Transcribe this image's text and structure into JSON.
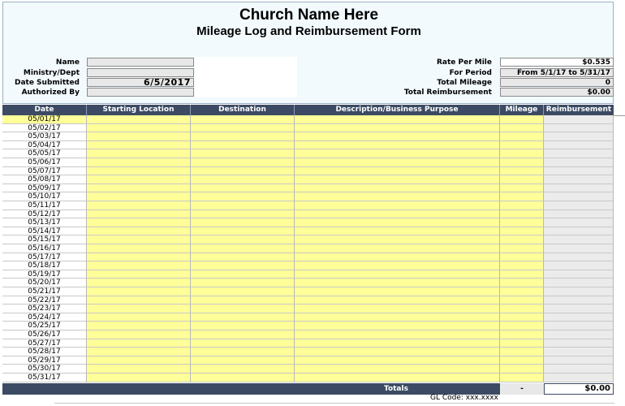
{
  "header": {
    "church_name": "Church Name Here",
    "form_title": "Mileage Log and Reimbursement Form"
  },
  "left_info": [
    {
      "label": "Name",
      "value": ""
    },
    {
      "label": "Ministry/Dept",
      "value": ""
    },
    {
      "label": "Date Submitted",
      "value": "6/5/2017"
    },
    {
      "label": "Authorized By",
      "value": ""
    }
  ],
  "right_info": [
    {
      "label": "Rate Per Mile",
      "value": "$0.535"
    },
    {
      "label": "For Period",
      "value": "From 5/1/17 to 5/31/17"
    },
    {
      "label": "Total Mileage",
      "value": "0"
    },
    {
      "label": "Total Reimbursement",
      "value": "$0.00"
    }
  ],
  "columns": [
    "Date",
    "Starting Location",
    "Destination",
    "Description/Business Purpose",
    "Mileage",
    "Reimbursement"
  ],
  "rows": [
    "05/01/17",
    "05/02/17",
    "05/03/17",
    "05/04/17",
    "05/05/17",
    "05/06/17",
    "05/07/17",
    "05/08/17",
    "05/09/17",
    "05/10/17",
    "05/11/17",
    "05/12/17",
    "05/13/17",
    "05/14/17",
    "05/15/17",
    "05/16/17",
    "05/17/17",
    "05/18/17",
    "05/19/17",
    "05/20/17",
    "05/21/17",
    "05/22/17",
    "05/23/17",
    "05/24/17",
    "05/25/17",
    "05/26/17",
    "05/27/17",
    "05/28/17",
    "05/29/17",
    "05/30/17",
    "05/31/17"
  ],
  "totals": {
    "label": "Totals",
    "mileage": "-",
    "reimbursement": "$0.00"
  },
  "footer": {
    "gl_code": "GL Code: xxx.xxxx"
  },
  "colors": {
    "header_bg": "#f2fafe",
    "column_header_bg": "#3c4b63",
    "input_yellow": "#ffff99",
    "reimbursement_grey": "#ebebeb"
  }
}
